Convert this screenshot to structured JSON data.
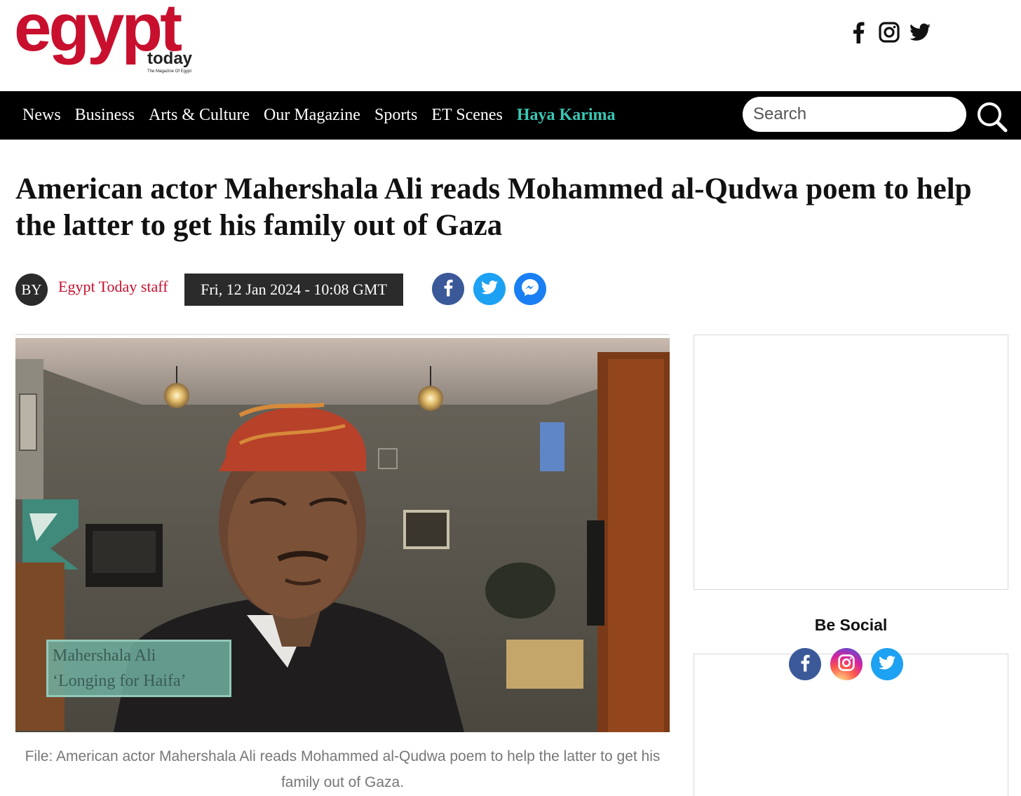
{
  "brand": {
    "logo_main": "egypt",
    "logo_sub": "today",
    "tagline": "The Magazine Of Egypt",
    "color": "#c8102e"
  },
  "header_social": [
    "facebook-icon",
    "instagram-icon",
    "twitter-icon"
  ],
  "nav": {
    "items": [
      "News",
      "Business",
      "Arts & Culture",
      "Our Magazine",
      "Sports",
      "ET Scenes",
      "Haya Karima"
    ],
    "highlight_color": "#3ac6b4",
    "search_placeholder": "Search"
  },
  "article": {
    "title": "American actor Mahershala Ali reads Mohammed al-Qudwa poem to help the latter to get his family out of Gaza",
    "by_label": "BY",
    "author": "Egypt Today staff",
    "date": "Fri, 12 Jan 2024 - 10:08 GMT",
    "share_icons": [
      "facebook-icon",
      "twitter-icon",
      "messenger-icon"
    ],
    "image": {
      "lower_third_line1": "Mahershala Ali",
      "lower_third_line2": "‘Longing for Haifa’"
    },
    "caption": "File: American actor Mahershala Ali reads Mohammed al-Qudwa poem to help the latter to get his family out of Gaza."
  },
  "sidebar": {
    "be_social": "Be Social",
    "social_icons": [
      "facebook-icon",
      "instagram-icon",
      "twitter-icon"
    ]
  }
}
